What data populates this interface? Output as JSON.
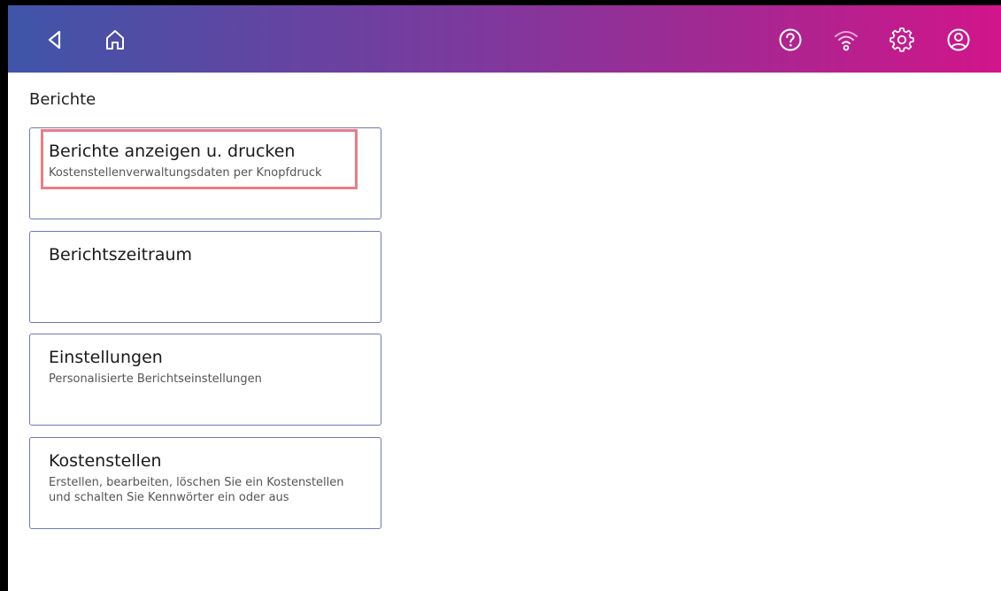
{
  "header": {
    "icons": [
      "back-icon",
      "home-icon",
      "help-icon",
      "wifi-icon",
      "settings-icon",
      "account-icon"
    ],
    "gradient_colors": [
      "#3f55a8",
      "#7a3a9e",
      "#b0238f",
      "#d1158a"
    ]
  },
  "page": {
    "section_title": "Berichte"
  },
  "menu": {
    "items": [
      {
        "title": "Berichte anzeigen u. drucken",
        "description": "Kostenstellenverwaltungsdaten per Knopfdruck"
      },
      {
        "title": "Berichtszeitraum",
        "description": ""
      },
      {
        "title": "Einstellungen",
        "description": "Personalisierte Berichtseinstellungen"
      },
      {
        "title": "Kostenstellen",
        "description": "Erstellen, bearbeiten, löschen Sie ein Kostenstellen und schalten Sie Kennwörter ein oder aus"
      }
    ]
  },
  "colors": {
    "card_border": "#6f78b8",
    "highlight": "#ea7d85"
  }
}
